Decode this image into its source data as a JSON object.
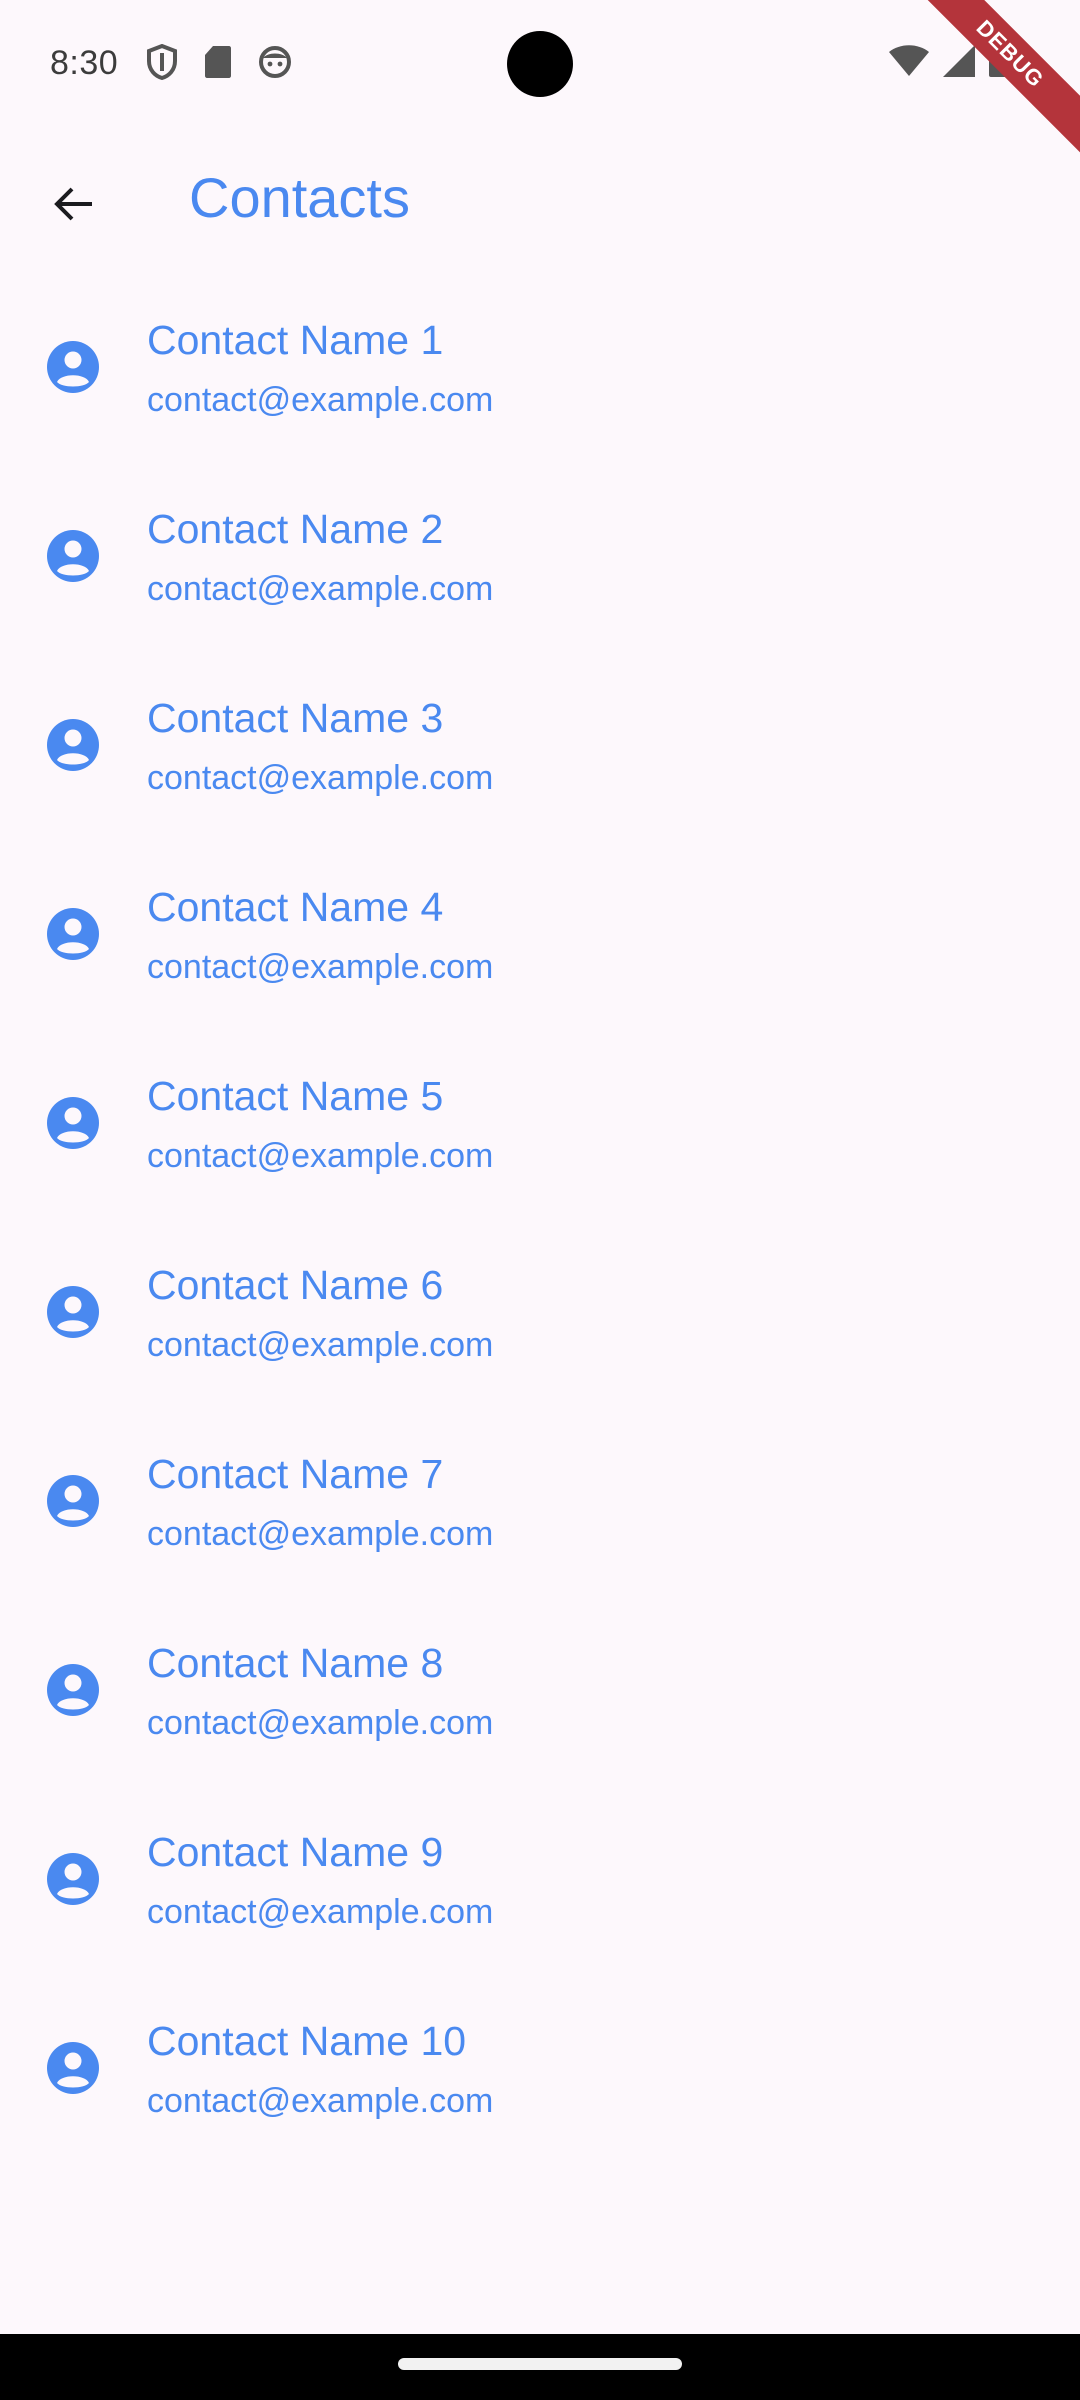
{
  "status_bar": {
    "time": "8:30",
    "left_icons": [
      "shield-icon",
      "sd-card-icon",
      "face-icon"
    ],
    "right_icons": [
      "wifi-icon",
      "cellular-signal-icon",
      "battery-icon"
    ],
    "debug_label": "DEBUG"
  },
  "app_bar": {
    "back_icon": "arrow-back-icon",
    "title": "Contacts"
  },
  "contacts": [
    {
      "name": "Contact Name 1",
      "email": "contact@example.com"
    },
    {
      "name": "Contact Name 2",
      "email": "contact@example.com"
    },
    {
      "name": "Contact Name 3",
      "email": "contact@example.com"
    },
    {
      "name": "Contact Name 4",
      "email": "contact@example.com"
    },
    {
      "name": "Contact Name 5",
      "email": "contact@example.com"
    },
    {
      "name": "Contact Name 6",
      "email": "contact@example.com"
    },
    {
      "name": "Contact Name 7",
      "email": "contact@example.com"
    },
    {
      "name": "Contact Name 8",
      "email": "contact@example.com"
    },
    {
      "name": "Contact Name 9",
      "email": "contact@example.com"
    },
    {
      "name": "Contact Name 10",
      "email": "contact@example.com"
    }
  ],
  "colors": {
    "accent": "#4a89f0",
    "background": "#fdf8fc",
    "debug_banner": "#b4343b"
  }
}
